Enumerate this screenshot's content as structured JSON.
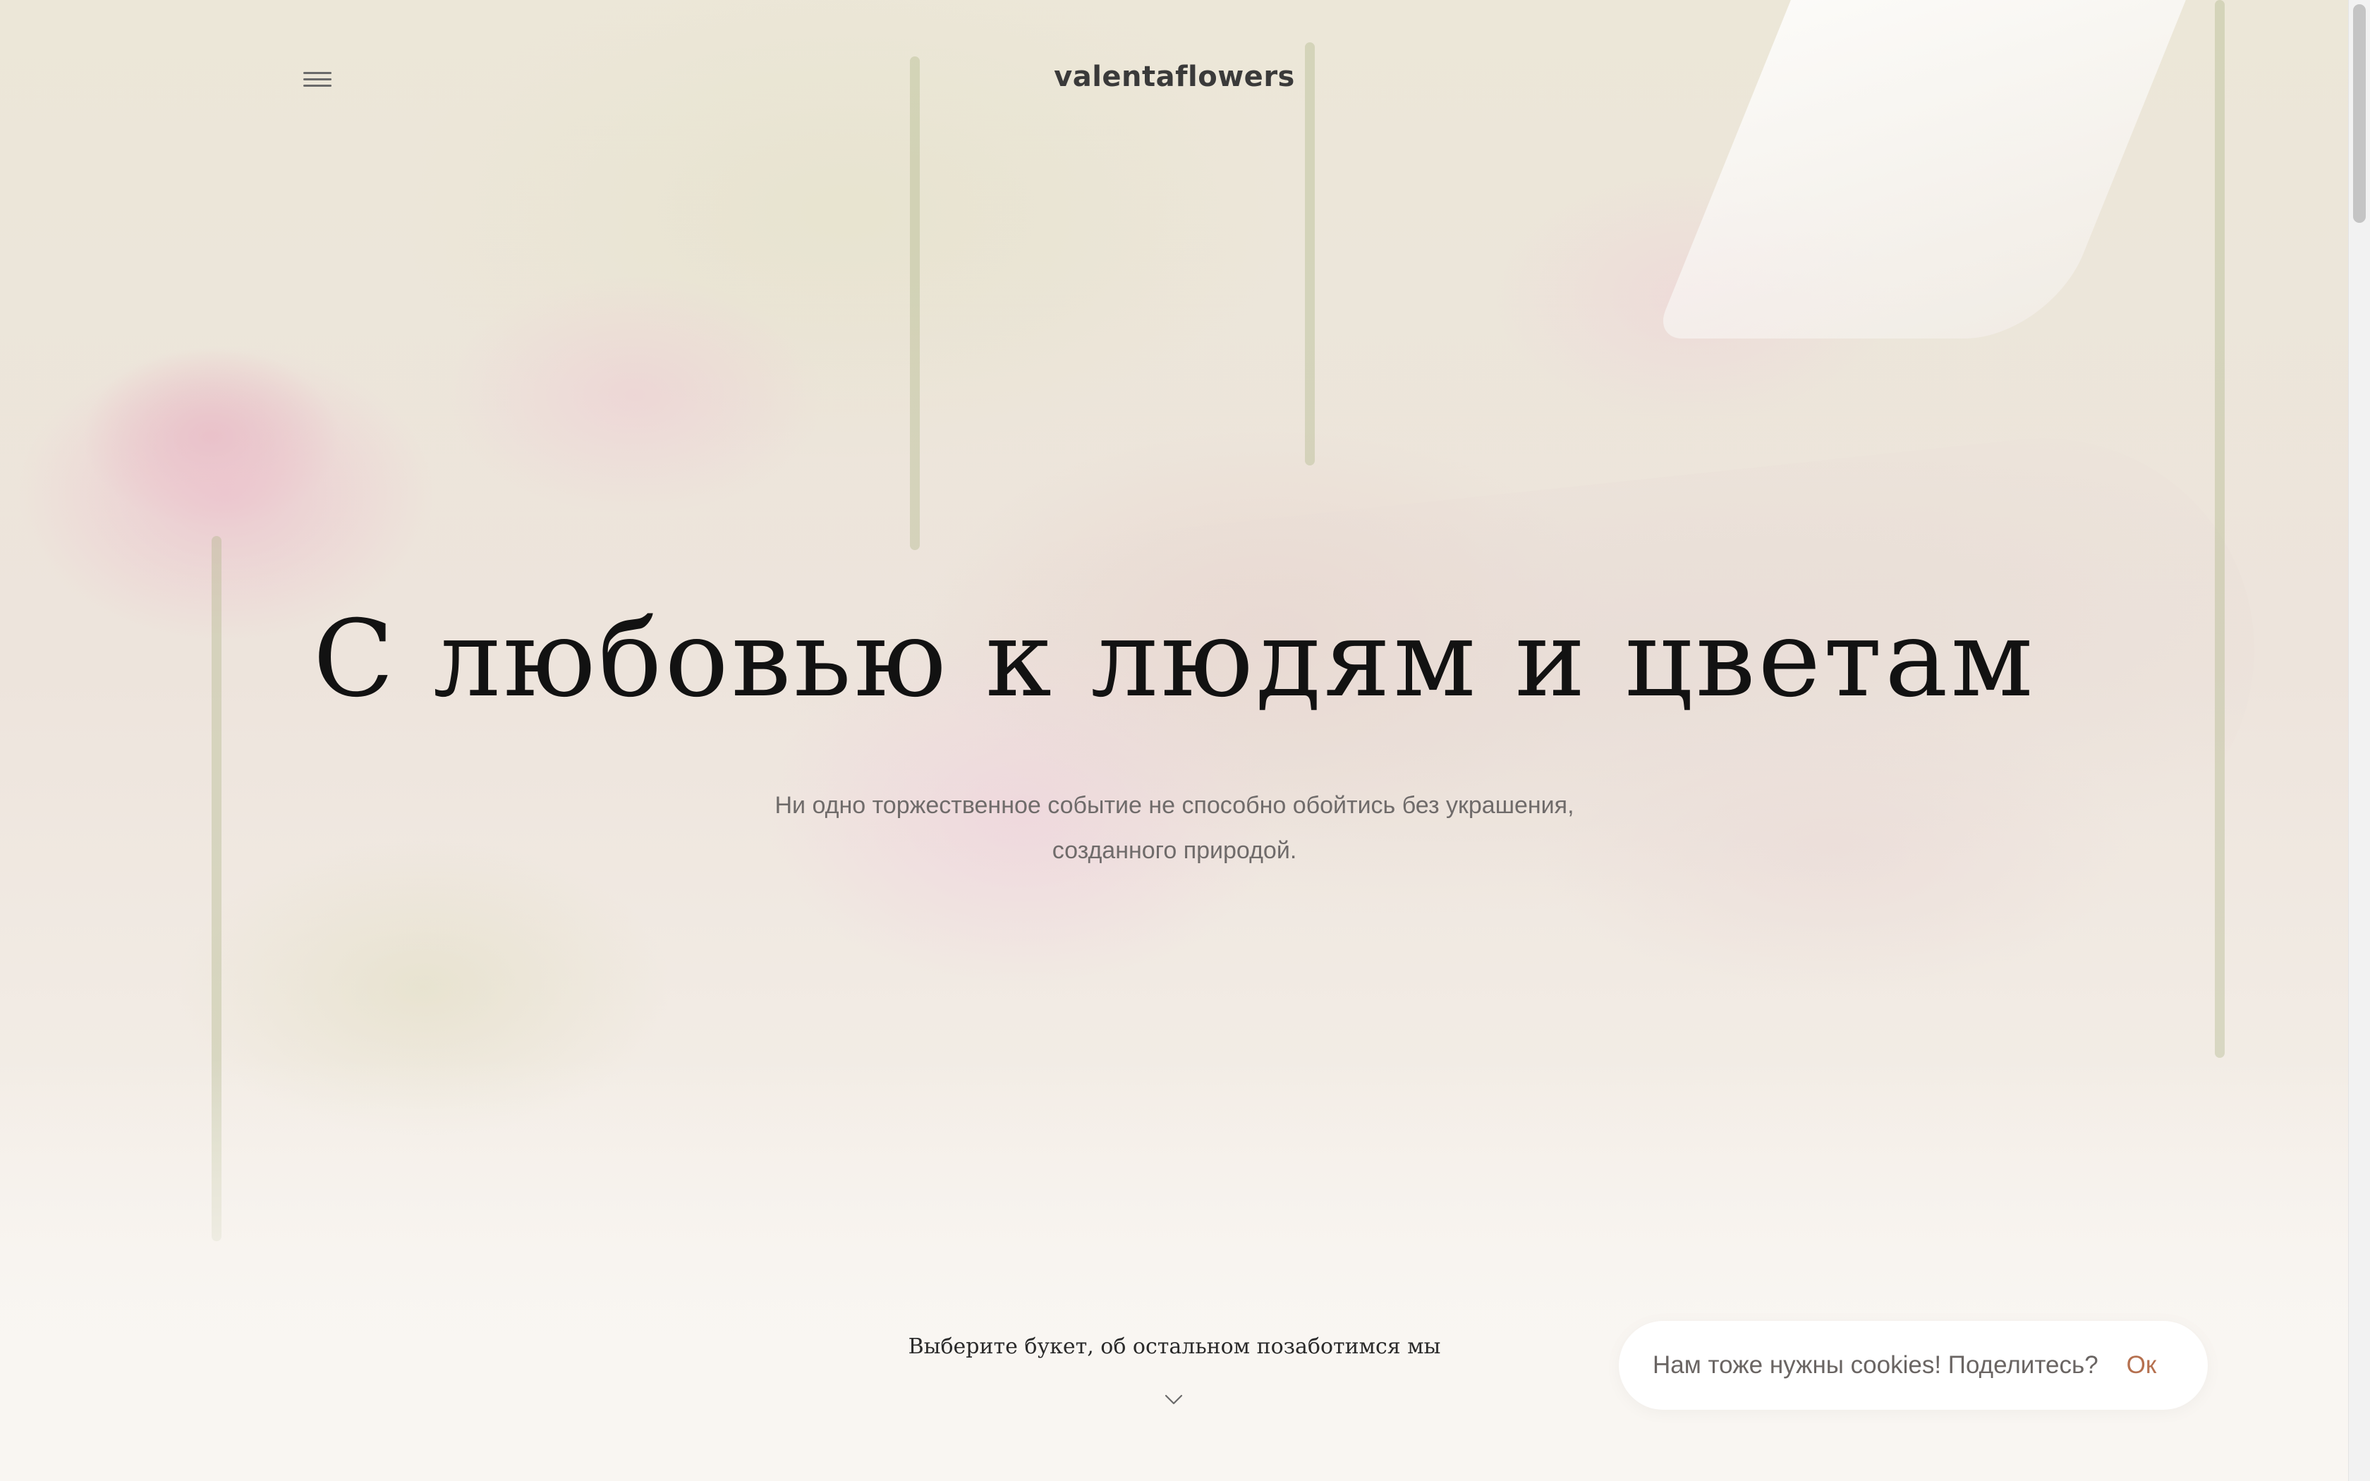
{
  "header": {
    "menu_icon": "hamburger-menu-icon",
    "brand": "valentaflowers"
  },
  "hero": {
    "title": "С любовью к людям и цветам",
    "subtitle_line1": "Ни одно торжественное событие не способно обойтись без украшения,",
    "subtitle_line2": "созданного природой.",
    "scroll_cta": "Выберите букет, об остальном позаботимся мы",
    "scroll_icon": "chevron-down-icon"
  },
  "cookie_banner": {
    "text": "Нам тоже нужны cookies! Поделитесь?",
    "ok_label": "Ок"
  },
  "colors": {
    "accent": "#b5704f",
    "title": "#121212",
    "muted_text": "#6f6b6a"
  }
}
